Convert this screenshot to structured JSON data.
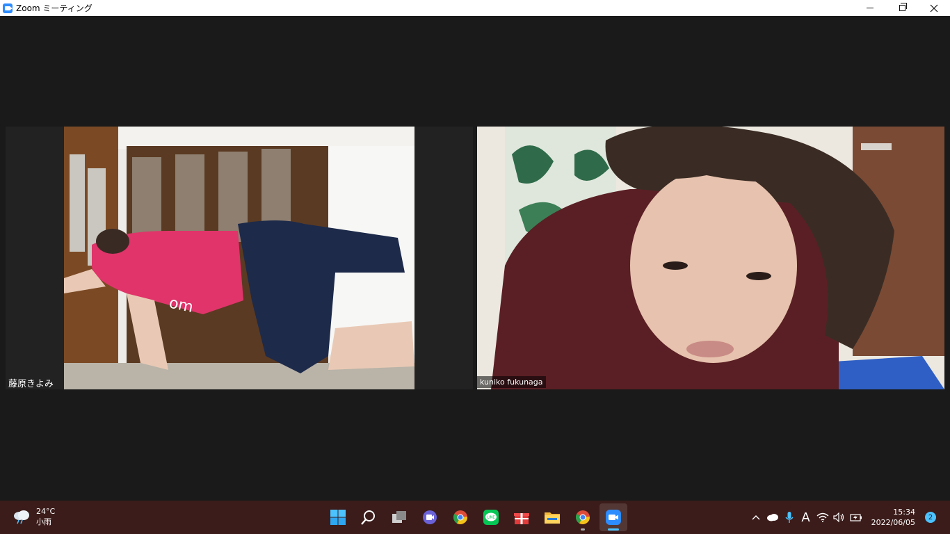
{
  "window": {
    "title": "Zoom ミーティング"
  },
  "participants": [
    {
      "name": "藤原きよみ"
    },
    {
      "name": "kuniko fukunaga"
    }
  ],
  "taskbar": {
    "weather": {
      "temp": "24°C",
      "condition": "小雨",
      "icon": "rain-cloud-icon"
    },
    "apps": [
      {
        "name": "start",
        "icon": "windows-start-icon"
      },
      {
        "name": "search",
        "icon": "search-icon"
      },
      {
        "name": "task-view",
        "icon": "task-view-icon"
      },
      {
        "name": "teams-chat",
        "icon": "teams-chat-icon"
      },
      {
        "name": "chrome",
        "icon": "chrome-icon"
      },
      {
        "name": "line",
        "icon": "line-icon"
      },
      {
        "name": "gift",
        "icon": "gift-icon"
      },
      {
        "name": "file-explorer",
        "icon": "folder-icon"
      },
      {
        "name": "chrome-2",
        "icon": "chrome-icon"
      },
      {
        "name": "zoom",
        "icon": "zoom-icon"
      }
    ],
    "tray": {
      "clock_time": "15:34",
      "clock_date": "2022/06/05",
      "ime": "A",
      "notification_count": "2"
    }
  },
  "colors": {
    "zoom_blue": "#2d8cff",
    "taskbar_bg": "#3b1c1a",
    "meeting_bg": "#1a1a1a",
    "accent": "#4cc2ff"
  }
}
